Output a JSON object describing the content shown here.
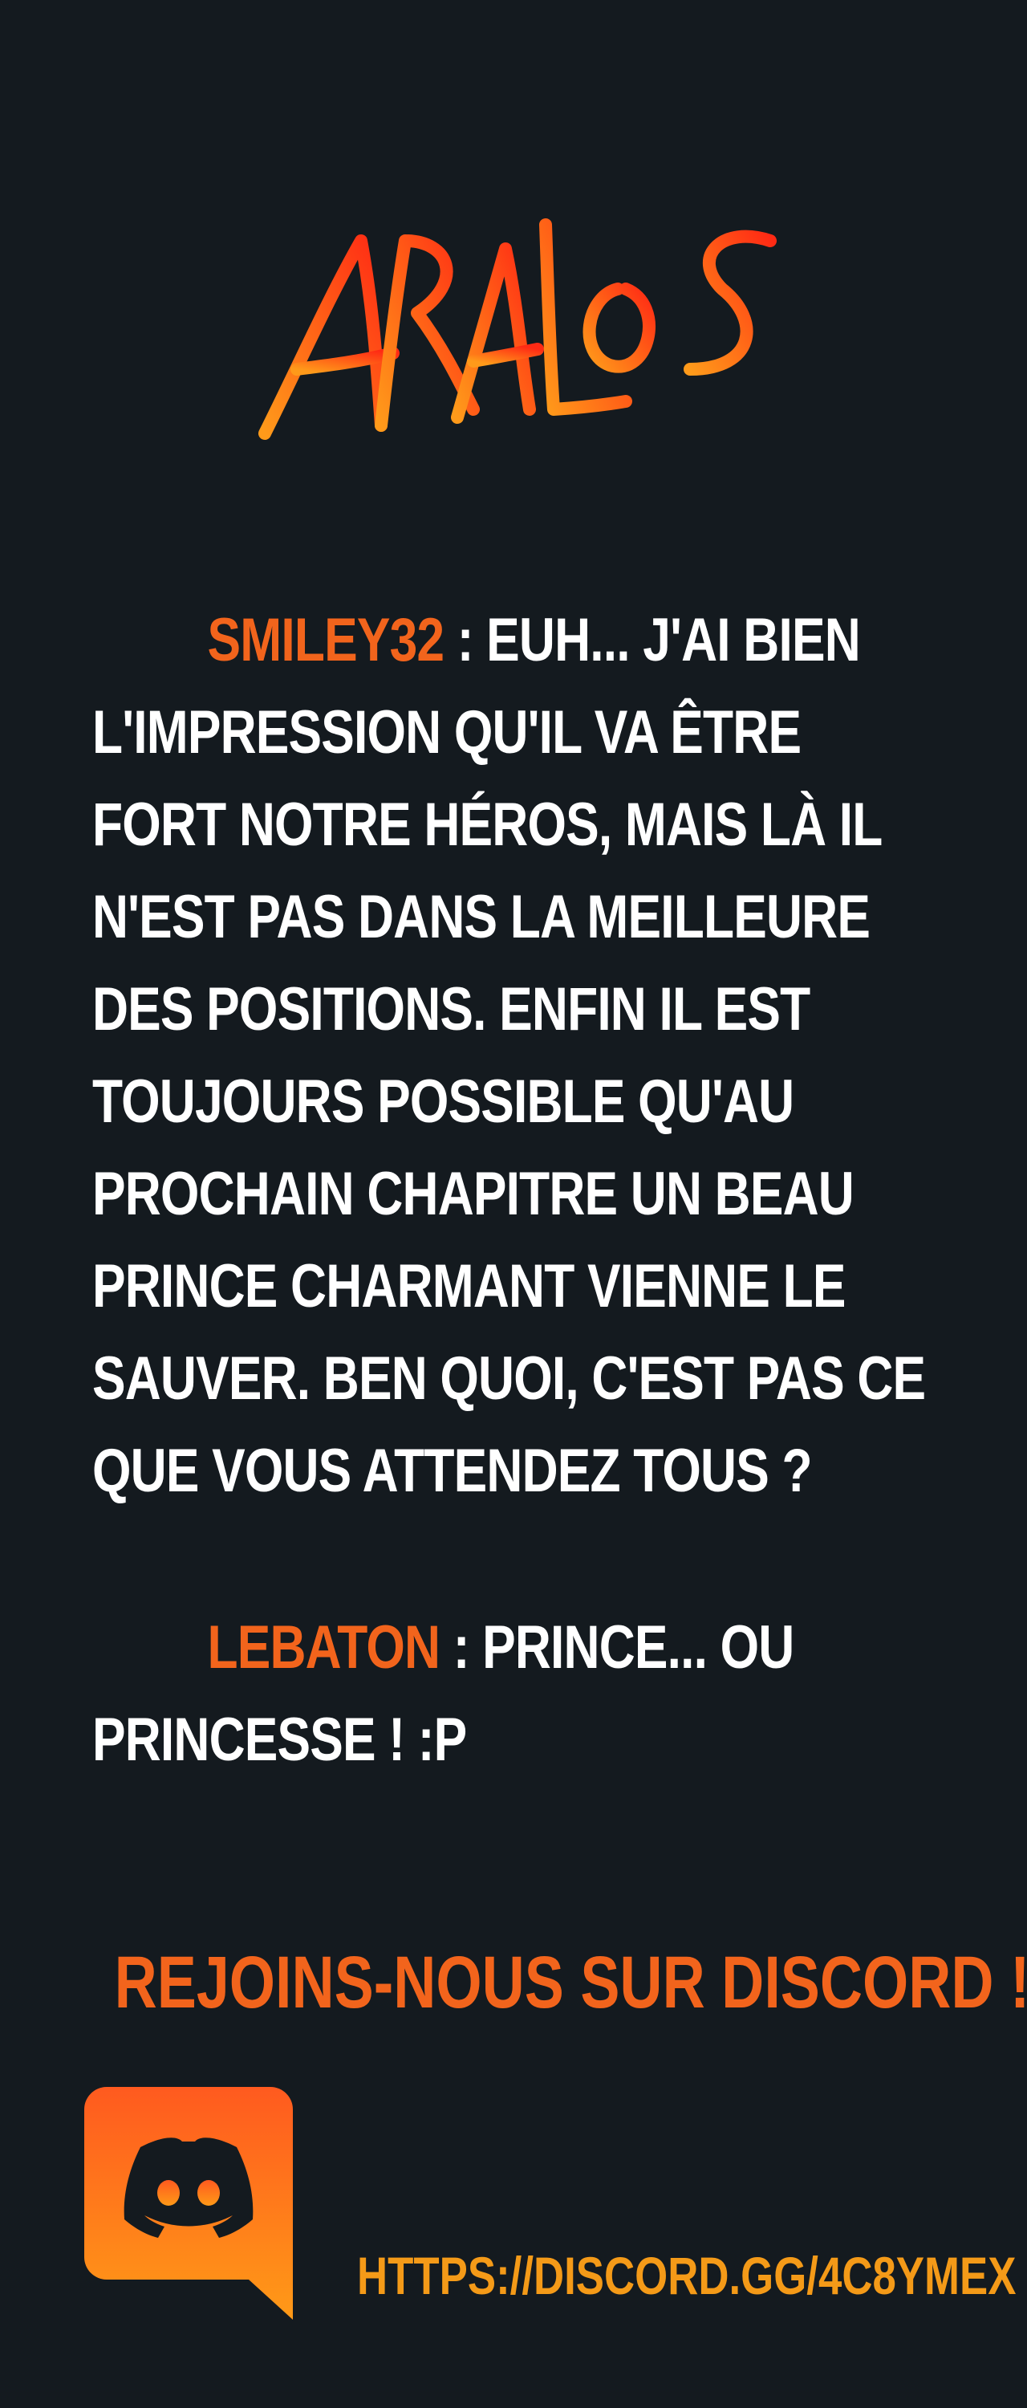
{
  "brand": {
    "logo_text": "ARALOS"
  },
  "comments": [
    {
      "author": "SMILEY32",
      "text": " : EUH... J'AI BIEN L'IMPRESSION QU'IL VA ÊTRE FORT NOTRE HÉROS, MAIS LÀ IL N'EST PAS DANS LA MEILLEURE DES POSITIONS. ENFIN IL EST TOUJOURS POSSIBLE QU'AU PROCHAIN CHAPITRE UN BEAU PRINCE CHARMANT VIENNE LE SAUVER. BEN QUOI, C'EST PAS CE QUE VOUS ATTENDEZ TOUS ?"
    },
    {
      "author": "LEBATON",
      "text": " : PRINCE... OU PRINCESSE ! :P"
    }
  ],
  "cta": {
    "text": "REJOINS-NOUS SUR DISCORD !"
  },
  "discord": {
    "wordmark": "DISCORD",
    "url": "HTTPS://DISCORD.GG/4C8YMEX"
  },
  "colors": {
    "background": "#141a1f",
    "accent": "#f2641c",
    "text": "#ffffff",
    "gradient_top": "#ff5a1f",
    "gradient_bottom": "#ff9a17"
  }
}
